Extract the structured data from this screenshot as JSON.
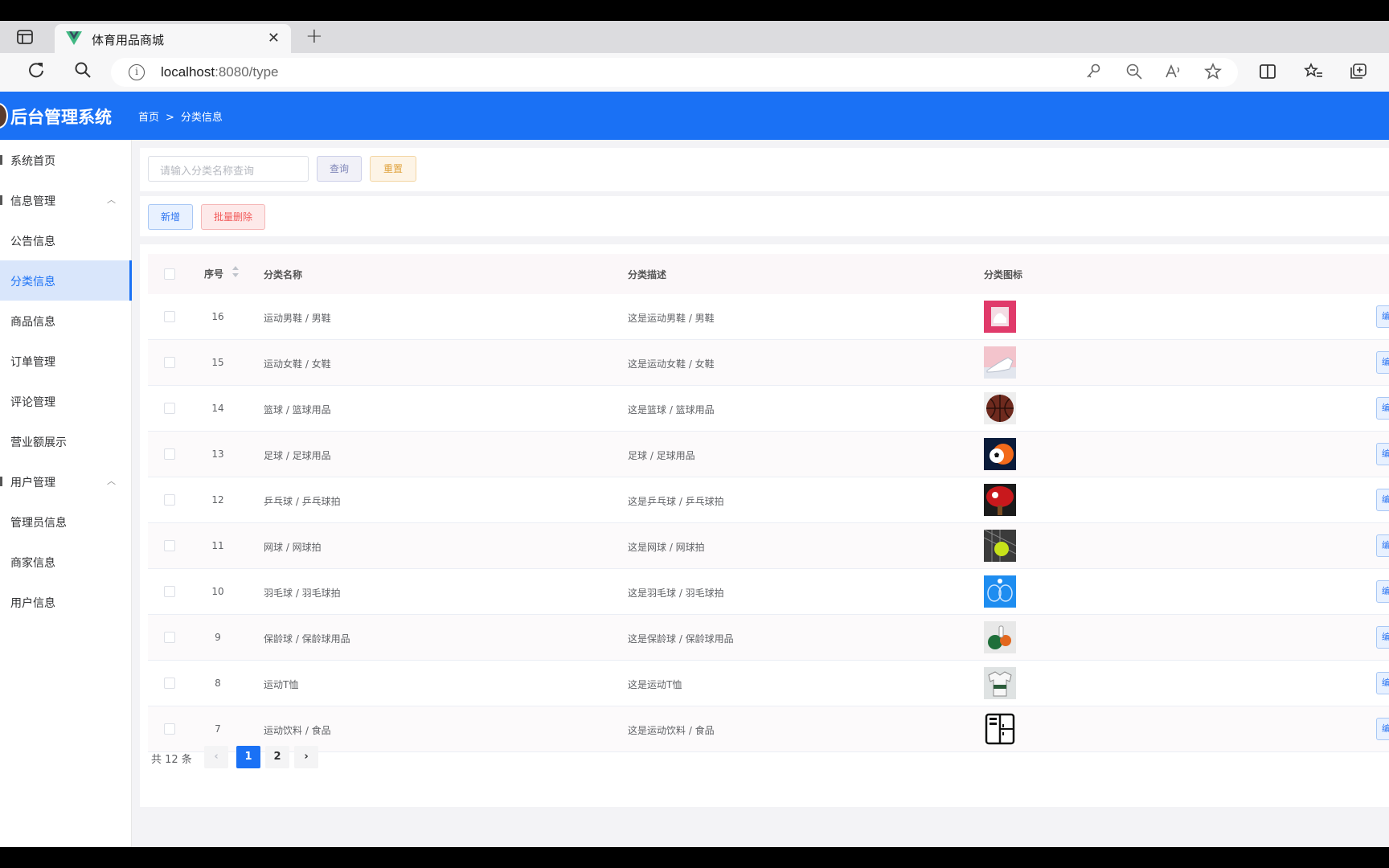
{
  "browser": {
    "tab_title": "体育用品商城",
    "close_glyph": "✕",
    "new_tab_glyph": "+",
    "url_host": "localhost",
    "url_path": ":8080/type",
    "info_glyph": "i"
  },
  "app": {
    "title": "后台管理系统",
    "accent": "#1a71f5"
  },
  "breadcrumb": {
    "home": "首页",
    "separator": ">",
    "current": "分类信息"
  },
  "sidebar": {
    "items": [
      {
        "label": "系统首页"
      },
      {
        "label": "信息管理",
        "chevron": "︿"
      },
      {
        "label": "公告信息"
      },
      {
        "label": "分类信息"
      },
      {
        "label": "商品信息"
      },
      {
        "label": "订单管理"
      },
      {
        "label": "评论管理"
      },
      {
        "label": "营业额展示"
      },
      {
        "label": "用户管理",
        "chevron": "︿"
      },
      {
        "label": "管理员信息"
      },
      {
        "label": "商家信息"
      },
      {
        "label": "用户信息"
      }
    ]
  },
  "search": {
    "placeholder": "请输入分类名称查询",
    "query_label": "查询",
    "reset_label": "重置"
  },
  "actions": {
    "add_label": "新增",
    "batch_delete_label": "批量删除"
  },
  "table": {
    "columns": [
      "序号",
      "分类名称",
      "分类描述",
      "分类图标"
    ],
    "edit_label": "编",
    "rows": [
      {
        "id": "16",
        "name": "运动男鞋 / 男鞋",
        "desc": "这是运动男鞋 / 男鞋",
        "icon": "shoe-box-icon"
      },
      {
        "id": "15",
        "name": "运动女鞋 / 女鞋",
        "desc": "这是运动女鞋 / 女鞋",
        "icon": "women-shoe-icon"
      },
      {
        "id": "14",
        "name": "篮球 / 篮球用品",
        "desc": "这是篮球 / 篮球用品",
        "icon": "basketball-icon"
      },
      {
        "id": "13",
        "name": "足球 / 足球用品",
        "desc": "足球 / 足球用品",
        "icon": "football-icon"
      },
      {
        "id": "12",
        "name": "乒乓球 / 乒乓球拍",
        "desc": "这是乒乓球 / 乒乓球拍",
        "icon": "pingpong-icon"
      },
      {
        "id": "11",
        "name": "网球 / 网球拍",
        "desc": "这是网球 / 网球拍",
        "icon": "tennis-icon"
      },
      {
        "id": "10",
        "name": "羽毛球 / 羽毛球拍",
        "desc": "这是羽毛球 / 羽毛球拍",
        "icon": "badminton-icon"
      },
      {
        "id": "9",
        "name": "保龄球 / 保龄球用品",
        "desc": "这是保龄球 / 保龄球用品",
        "icon": "bowling-icon"
      },
      {
        "id": "8",
        "name": "运动T恤",
        "desc": "这是运动T恤",
        "icon": "tshirt-icon"
      },
      {
        "id": "7",
        "name": "运动饮料 / 食品",
        "desc": "这是运动饮料 / 食品",
        "icon": "fridge-icon"
      }
    ]
  },
  "pagination": {
    "total_text": "共 12 条",
    "prev": "‹",
    "pages": [
      "1",
      "2"
    ],
    "current_page": "1",
    "next": "›"
  }
}
